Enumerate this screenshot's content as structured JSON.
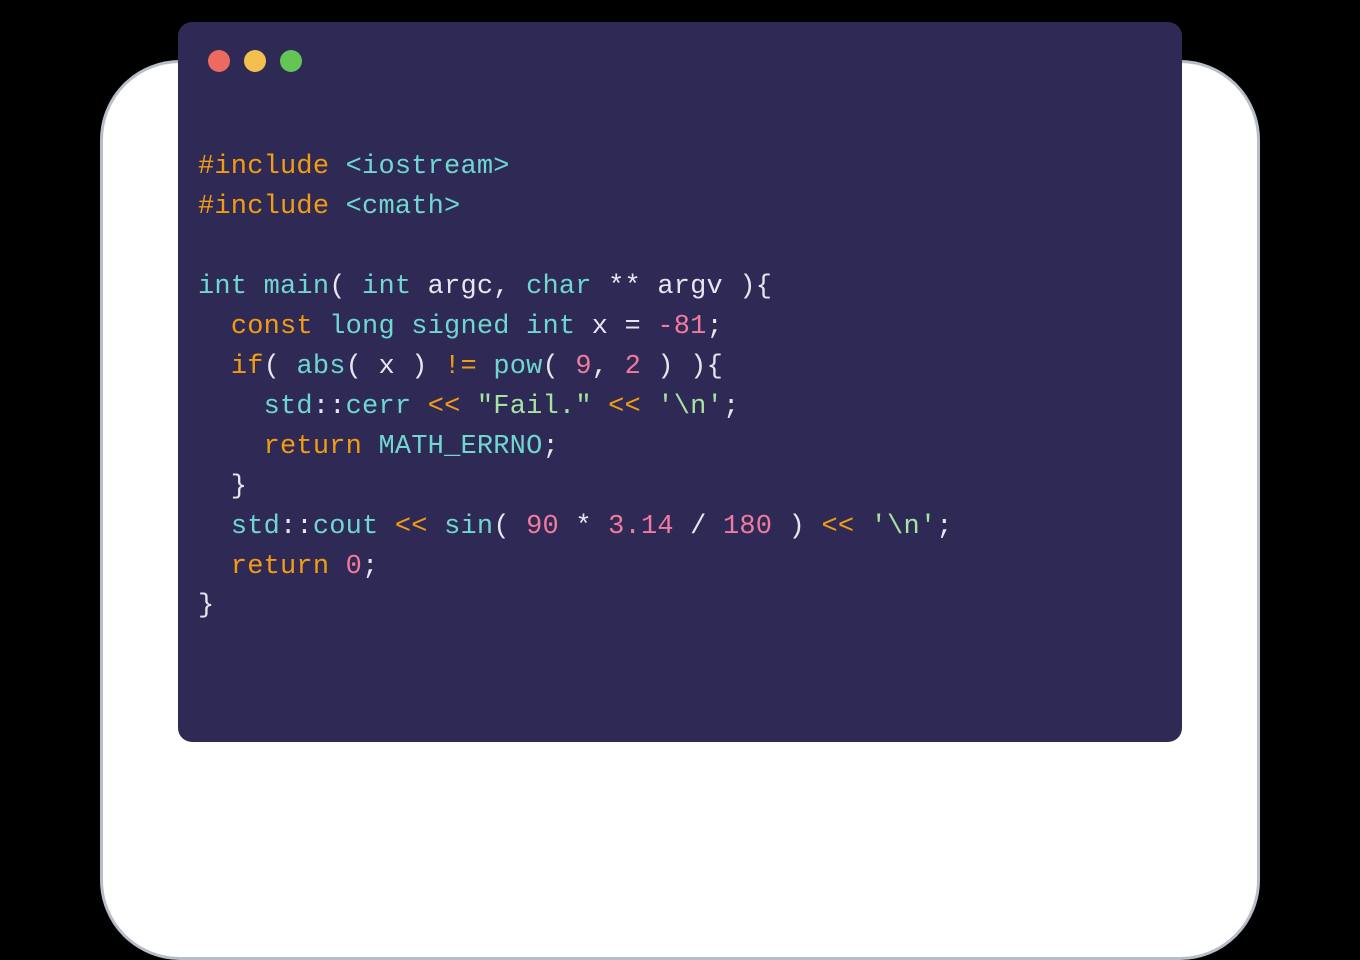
{
  "code": {
    "line1_include": "#include",
    "line1_header": " <iostream>",
    "line2_include": "#include",
    "line2_header": " <cmath>",
    "blank": "",
    "l4_int": "int",
    "l4_main": " main",
    "l4_open": "( ",
    "l4_int2": "int",
    "l4_argc": " argc",
    "l4_comma": ", ",
    "l4_char": "char",
    "l4_stars": " ** ",
    "l4_argv": "argv",
    "l4_close": " ){",
    "l5_indent": "  ",
    "l5_const": "const",
    "l5_type": " long signed int ",
    "l5_x": "x",
    "l5_eq": " = ",
    "l5_val": "-81",
    "l5_semi": ";",
    "l6_indent": "  ",
    "l6_if": "if",
    "l6_open": "( ",
    "l6_abs": "abs",
    "l6_open2": "( ",
    "l6_x": "x",
    "l6_close2": " ) ",
    "l6_neq": "!=",
    "l6_sp": " ",
    "l6_pow": "pow",
    "l6_open3": "( ",
    "l6_nine": "9",
    "l6_comma": ", ",
    "l6_two": "2",
    "l6_close3": " ) ){",
    "l7_indent": "    ",
    "l7_std": "std",
    "l7_cc": "::",
    "l7_cerr": "cerr",
    "l7_sp1": " ",
    "l7_lt1": "<<",
    "l7_sp2": " ",
    "l7_str": "\"Fail.\"",
    "l7_sp3": " ",
    "l7_lt2": "<<",
    "l7_sp4": " ",
    "l7_nl": "'\\n'",
    "l7_semi": ";",
    "l8_indent": "    ",
    "l8_return": "return",
    "l8_sp": " ",
    "l8_merr": "MATH_ERRNO",
    "l8_semi": ";",
    "l9": "  }",
    "l10_indent": "  ",
    "l10_std": "std",
    "l10_cc": "::",
    "l10_cout": "cout",
    "l10_sp1": " ",
    "l10_lt1": "<<",
    "l10_sp2": " ",
    "l10_sin": "sin",
    "l10_open": "( ",
    "l10_90": "90",
    "l10_m1": " * ",
    "l10_pi": "3.14",
    "l10_d": " / ",
    "l10_180": "180",
    "l10_close": " ) ",
    "l10_lt2": "<<",
    "l10_sp3": " ",
    "l10_nl": "'\\n'",
    "l10_semi": ";",
    "l11_indent": "  ",
    "l11_return": "return",
    "l11_sp": " ",
    "l11_zero": "0",
    "l11_semi": ";",
    "l12": "}"
  }
}
